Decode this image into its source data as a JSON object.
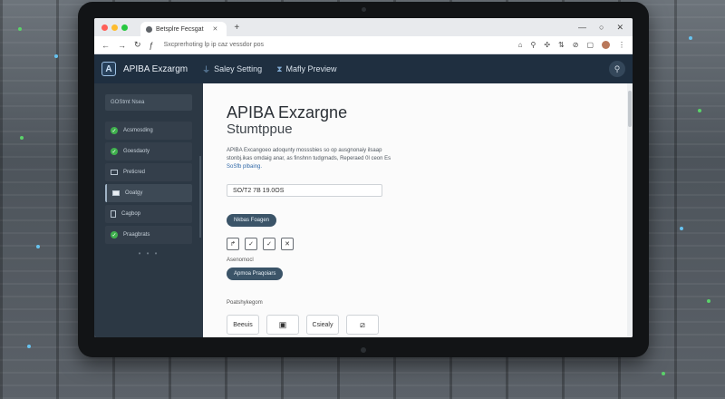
{
  "browser": {
    "tab_title": "Betsplre Fecsgat",
    "new_tab": "+",
    "url": "Sxcprerhoting lp ip caz vessdor pos"
  },
  "app": {
    "brand": "APIBA Exzargm",
    "logo_letter": "A",
    "nav": [
      {
        "label": "Saley Setting",
        "icon": "plug-icon"
      },
      {
        "label": "Mafly Preview",
        "icon": "hourglass-icon"
      }
    ]
  },
  "sidebar": {
    "top": "GOStmt Nsea",
    "items": [
      {
        "label": "Acsmosding",
        "state": "check"
      },
      {
        "label": "Goesdaoty",
        "state": "check"
      },
      {
        "label": "Preticred",
        "state": "box"
      },
      {
        "label": "Ooatgy",
        "state": "mail",
        "active": true
      },
      {
        "label": "Cagbop",
        "state": "doc"
      },
      {
        "label": "Praagbrats",
        "state": "check"
      }
    ],
    "dots": "• • •"
  },
  "main": {
    "title": "APIBA Exzargne",
    "subtitle": "Stumtppue",
    "desc_main": "APIBA Excangoeo adoqunty mosssbies so op ausgnonaiy ilsaap stonbj.ikas omdaig anar, as finshnn tudgmads, Reperaed",
    "desc_prefix": "0l ceon Es",
    "desc_link": "SoSfb plbaing.",
    "input_value": "SO/T2 7B 19.0OS",
    "pill_primary": "Nkbas Foagen",
    "icon_buttons": [
      "↱",
      "✓",
      "✓",
      "✕"
    ],
    "small_label": "Asenomocl",
    "pill_secondary": "Apmoa Praqoiars",
    "section_label": "Poatshykegom",
    "bottom_buttons": [
      {
        "label": "Beeuis",
        "kind": "text"
      },
      {
        "label": "▣",
        "kind": "icon"
      },
      {
        "label": "Csiealy",
        "kind": "text"
      },
      {
        "label": "⧄",
        "kind": "icon"
      }
    ]
  },
  "colors": {
    "header_bg": "#1f2f40",
    "sidebar_bg": "#2c3844",
    "check_green": "#3fb04d",
    "pill_bg": "#3b5468"
  }
}
